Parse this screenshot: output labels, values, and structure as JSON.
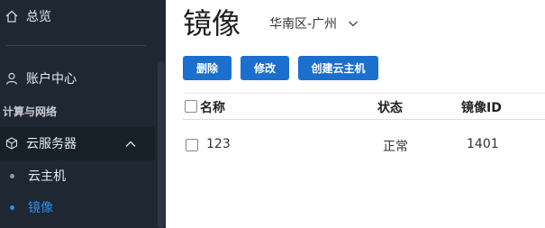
{
  "sidebar": {
    "overview_label": "总览",
    "account_label": "账户中心",
    "section_label": "计算与网络",
    "group": {
      "label": "云服务器",
      "items": [
        {
          "label": "云主机"
        },
        {
          "label": "镜像"
        }
      ]
    }
  },
  "main": {
    "title": "镜像",
    "region": "华南区-广州",
    "toolbar": {
      "delete_label": "删除",
      "edit_label": "修改",
      "create_label": "创建云主机"
    },
    "table": {
      "columns": [
        "名称",
        "状态",
        "镜像ID"
      ],
      "rows": [
        {
          "name": "123",
          "status": "正常",
          "id": "1401"
        }
      ]
    }
  },
  "colors": {
    "sidebar_bg": "#1f2733",
    "accent": "#1a6fcf",
    "active_item": "#2d8cf0"
  }
}
